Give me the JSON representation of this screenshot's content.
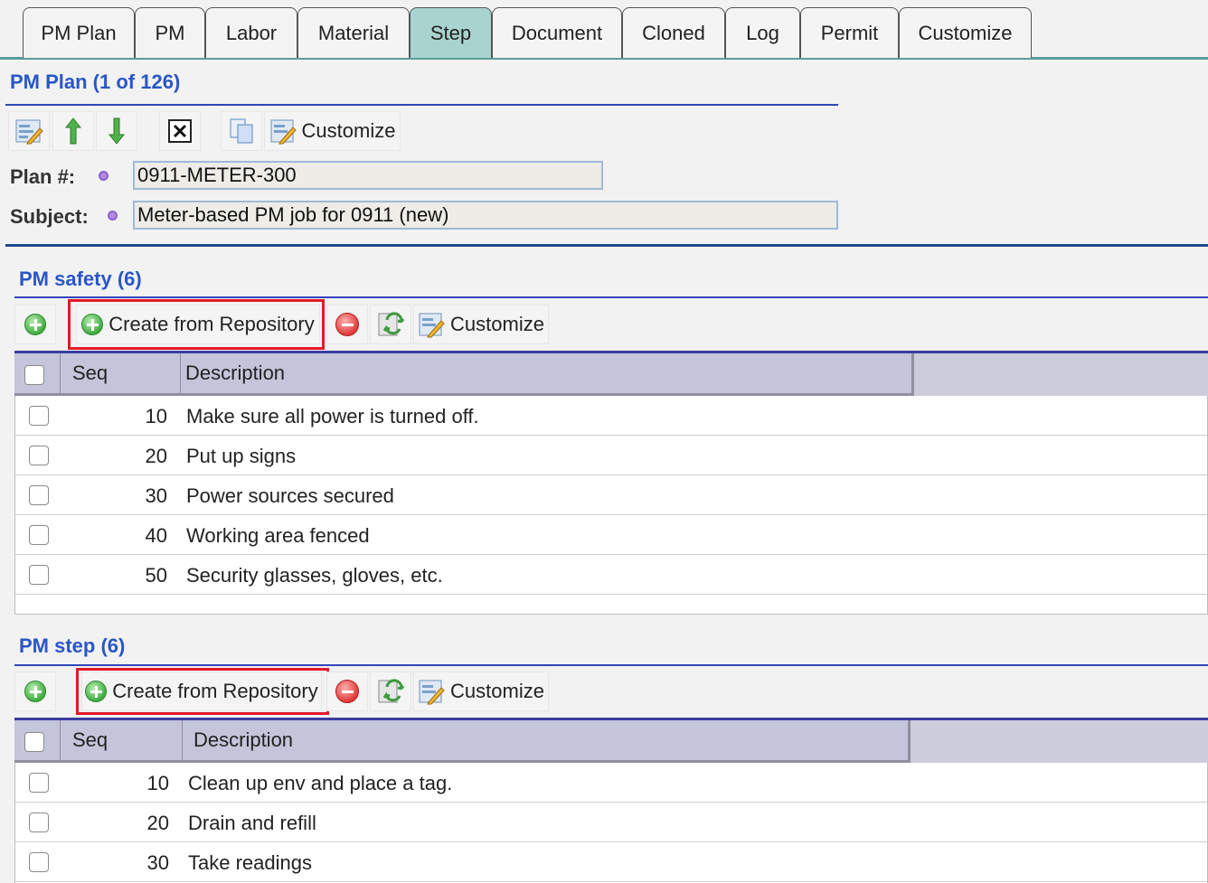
{
  "tabs": [
    {
      "label": "PM Plan",
      "active": false
    },
    {
      "label": "PM",
      "active": false
    },
    {
      "label": "Labor",
      "active": false
    },
    {
      "label": "Material",
      "active": false
    },
    {
      "label": "Step",
      "active": true
    },
    {
      "label": "Document",
      "active": false
    },
    {
      "label": "Cloned",
      "active": false
    },
    {
      "label": "Log",
      "active": false
    },
    {
      "label": "Permit",
      "active": false
    },
    {
      "label": "Customize",
      "active": false
    }
  ],
  "header": {
    "title": "PM Plan (1 of 126)",
    "toolbar": {
      "customize_label": "Customize"
    },
    "fields": {
      "plan_label": "Plan #:",
      "plan_value": "0911-METER-300",
      "subject_label": "Subject:",
      "subject_value": "Meter-based PM job for 0911 (new)"
    }
  },
  "safety": {
    "title": "PM safety (6)",
    "create_label": "Create from Repository",
    "customize_label": "Customize",
    "columns": {
      "seq": "Seq",
      "description": "Description"
    },
    "rows": [
      {
        "seq": "10",
        "description": "Make sure all power is turned off."
      },
      {
        "seq": "20",
        "description": "Put up signs"
      },
      {
        "seq": "30",
        "description": "Power sources secured"
      },
      {
        "seq": "40",
        "description": "Working area fenced"
      },
      {
        "seq": "50",
        "description": "Security glasses, gloves, etc."
      }
    ]
  },
  "step": {
    "title": "PM step (6)",
    "create_label": "Create from Repository",
    "customize_label": "Customize",
    "columns": {
      "seq": "Seq",
      "description": "Description"
    },
    "rows": [
      {
        "seq": "10",
        "description": "Clean up env and place a tag."
      },
      {
        "seq": "20",
        "description": "Drain and refill"
      },
      {
        "seq": "30",
        "description": "Take readings"
      }
    ]
  },
  "colors": {
    "accent_blue": "#2a56c6",
    "active_tab": "#a8d3cf",
    "highlight_red": "#e3192a"
  }
}
